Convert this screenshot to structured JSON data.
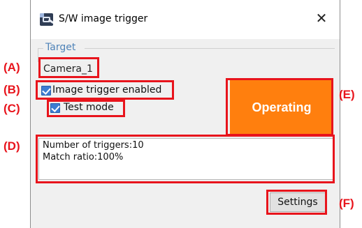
{
  "window": {
    "title": "S/W image trigger",
    "app_icon": "camera-trigger-icon",
    "close_icon": "close-icon",
    "close_glyph": "✕"
  },
  "target_group": {
    "label": "Target",
    "value": "Camera_1"
  },
  "checkboxes": [
    {
      "label": "Image trigger enabled",
      "checked": true
    },
    {
      "label": "Test mode",
      "checked": true
    }
  ],
  "status": {
    "text": "Operating",
    "color": "#ff7f0e"
  },
  "info": {
    "lines": [
      "Number of triggers:10",
      "Match ratio:100%"
    ]
  },
  "buttons": {
    "settings": "Settings"
  },
  "annotations": {
    "color": "#e8141c",
    "tags": [
      "(A)",
      "(B)",
      "(C)",
      "(D)",
      "(E)",
      "(F)"
    ]
  }
}
